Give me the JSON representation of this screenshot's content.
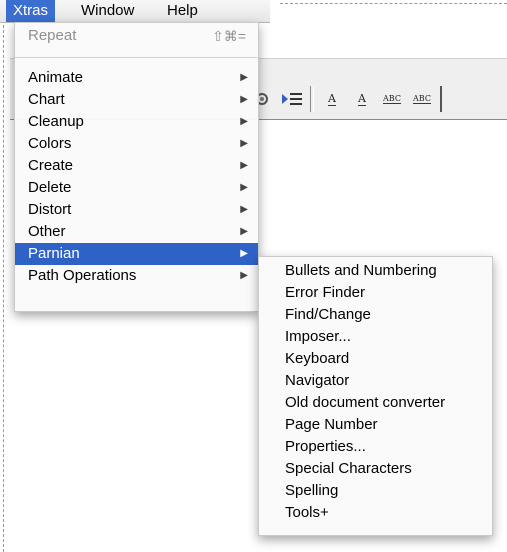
{
  "menubar": {
    "items": [
      {
        "label": "Xtras",
        "active": true
      },
      {
        "label": "Window",
        "active": false
      },
      {
        "label": "Help",
        "active": false
      }
    ]
  },
  "xtras_menu": {
    "repeat": {
      "label": "Repeat",
      "shortcut": "⇧⌘=",
      "enabled": false
    },
    "items": [
      {
        "label": "Animate"
      },
      {
        "label": "Chart"
      },
      {
        "label": "Cleanup"
      },
      {
        "label": "Colors"
      },
      {
        "label": "Create"
      },
      {
        "label": "Delete"
      },
      {
        "label": "Distort"
      },
      {
        "label": "Other"
      },
      {
        "label": "Parnian",
        "highlighted": true
      },
      {
        "label": "Path Operations"
      }
    ],
    "submenu_arrow": "▶"
  },
  "parnian_submenu": {
    "items": [
      "Bullets and Numbering",
      "Error Finder",
      "Find/Change",
      "Imposer...",
      "Keyboard",
      "Navigator",
      "Old document converter",
      "Page Number",
      "Properties...",
      "Special Characters",
      "Spelling",
      "Tools+"
    ]
  },
  "toolbar": {
    "icons": [
      "gear-icon",
      "text-indent-icon",
      "tracking-a-icon",
      "tracking-a2-icon",
      "abc-baseline-icon",
      "abc-superscript-icon"
    ],
    "text_icons": [
      "A",
      "A",
      "ABC",
      "ABC"
    ]
  },
  "colors": {
    "highlight": "#2f62c6",
    "menubar_active": "#3a6fd0"
  }
}
